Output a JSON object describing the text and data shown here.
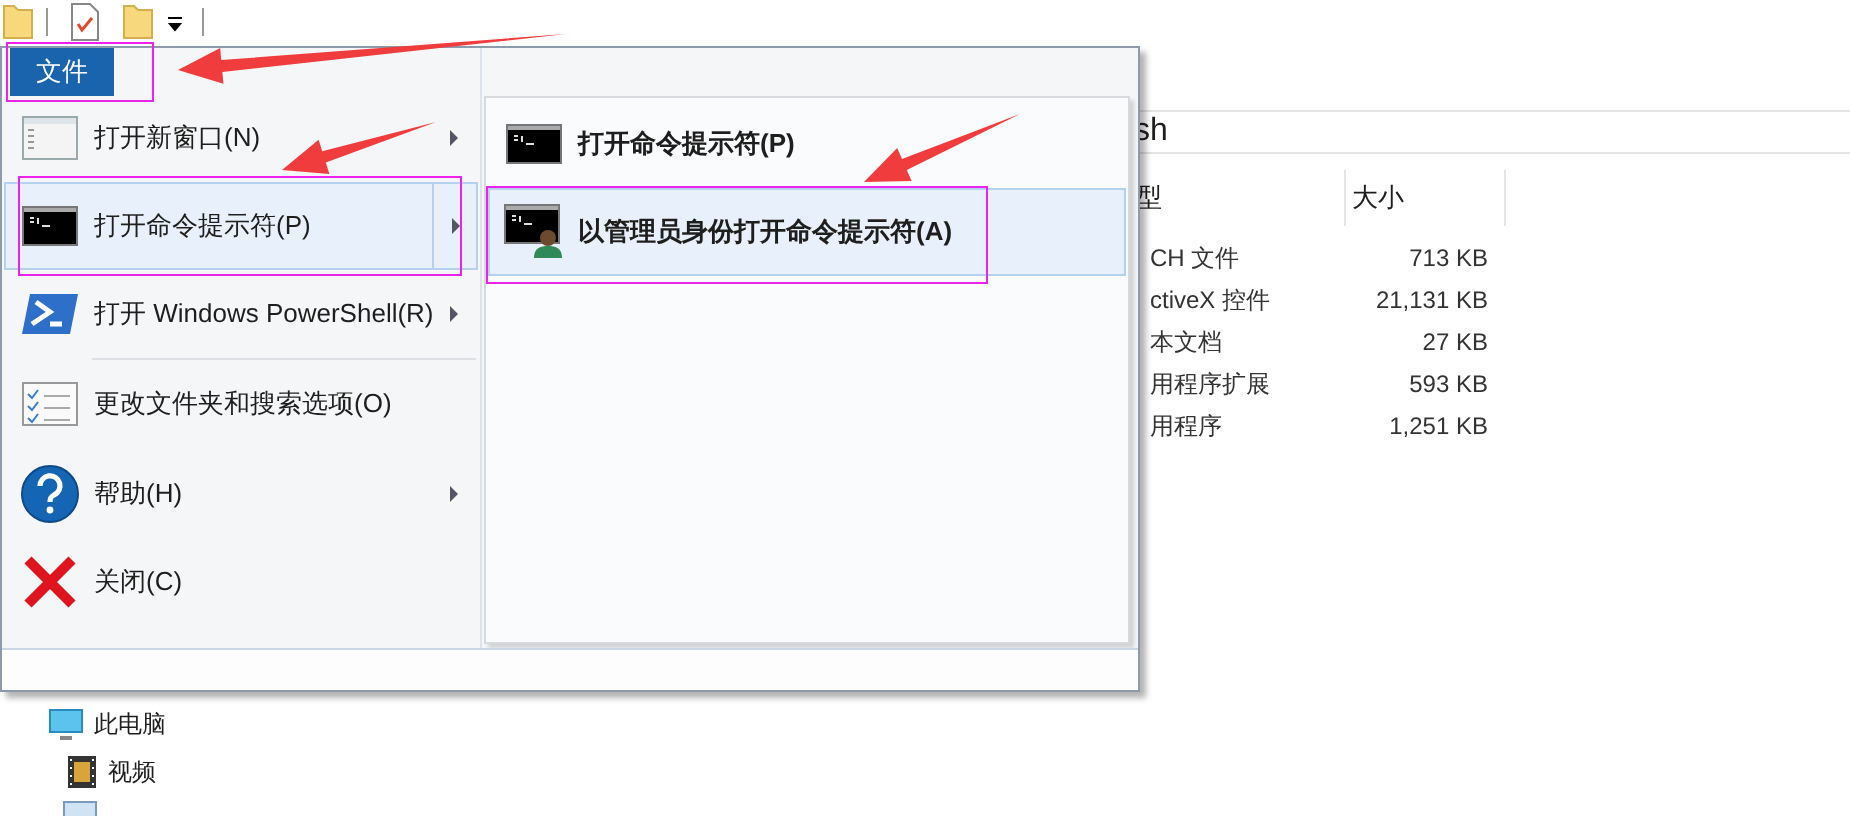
{
  "file_tab": {
    "label": "文件",
    "selected": true
  },
  "menu": {
    "items": [
      {
        "kind": "window",
        "label": "打开新窗口(N)",
        "submenu": true,
        "selected": false
      },
      {
        "kind": "console",
        "label": "打开命令提示符(P)",
        "submenu": true,
        "selected": true
      },
      {
        "kind": "powershell",
        "label": "打开 Windows PowerShell(R)",
        "submenu": true,
        "selected": false
      },
      {
        "kind": "options",
        "label": "更改文件夹和搜索选项(O)",
        "submenu": false,
        "selected": false
      },
      {
        "kind": "help",
        "label": "帮助(H)",
        "submenu": true,
        "selected": false
      },
      {
        "kind": "close",
        "label": "关闭(C)",
        "submenu": false,
        "selected": false
      }
    ]
  },
  "submenu": {
    "items": [
      {
        "kind": "console",
        "label": "打开命令提示符(P)",
        "selected": false
      },
      {
        "kind": "admin_console",
        "label": "以管理员身份打开命令提示符(A)",
        "selected": true
      }
    ]
  },
  "address_bar": {
    "value": "sh"
  },
  "file_list": {
    "columns": [
      "型",
      "大小"
    ],
    "rows": [
      {
        "type": "CH 文件",
        "size": "713 KB"
      },
      {
        "type": "ctiveX 控件",
        "size": "21,131 KB"
      },
      {
        "type": "本文档",
        "size": "27 KB"
      },
      {
        "type": "用程序扩展",
        "size": "593 KB"
      },
      {
        "type": "用程序",
        "size": "1,251 KB"
      }
    ]
  },
  "navigation": {
    "items": [
      {
        "kind": "computer",
        "label": "此电脑"
      },
      {
        "kind": "video",
        "label": "视频"
      }
    ]
  }
}
